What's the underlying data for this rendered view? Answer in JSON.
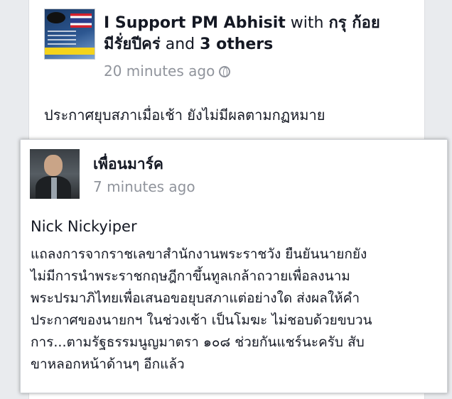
{
  "post": {
    "page_name": "I Support PM Abhisit",
    "connector": "with",
    "tagged_1": "กรุ ก้อย",
    "tagged_2": "มีรั่ยปีคร่",
    "and_text": "and",
    "others": "3 others",
    "time": "20 minutes ago",
    "privacy_icon": "globe-icon",
    "text": "ประกาศยุบสภาเมื่อเช้า ยังไม่มีผลตามกฏหมาย"
  },
  "shared": {
    "name": "เพื่อนมาร์ค",
    "time": "7 minutes ago",
    "author": "Nick Nickyiper",
    "lines": [
      "แถลงการจากราชเลขาสำนักงานพระราชวัง ยืนยันนายกยัง",
      "ไม่มีการนำพระราชกฤษฎีกาขึ้นทูลเกล้าถวายเพื่อลงนาม",
      "พระปรมาภิไทยเพื่อเสนอขอยุบสภาแต่อย่างใด ส่งผลให้คำ",
      "ประกาศของนายกฯ ในช่วงเช้า เป็นโมฆะ ไม่ชอบด้วยขบวน",
      "การ...ตามรัฐธรรมนูญมาตรา ๑๐๘ ช่วยกันแชร์นะครับ สับ",
      "ขาหลอกหน้าด้านๆ อีกแล้ว"
    ]
  }
}
